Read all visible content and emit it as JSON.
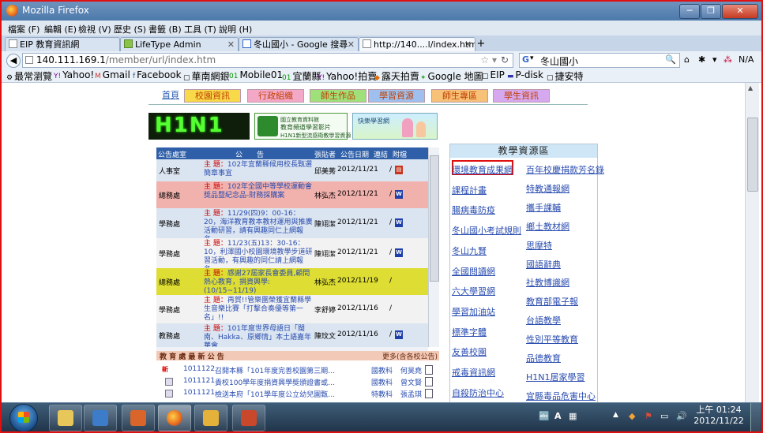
{
  "window": {
    "title": "Mozilla Firefox",
    "controls": {
      "minimize": "─",
      "maximize": "❐",
      "close": "✕"
    }
  },
  "menu": [
    "檔案 (F)",
    "編輯 (E)",
    "檢視 (V)",
    "歷史 (S)",
    "書籤 (B)",
    "工具 (T)",
    "說明 (H)"
  ],
  "tabs": [
    {
      "label": "EIP 教育資訊網"
    },
    {
      "label": "LifeType Admin"
    },
    {
      "label": "冬山國小 - Google 搜尋"
    },
    {
      "label": "http://140....l/index.htm"
    }
  ],
  "nav": {
    "url_host": "140.111.169.1",
    "url_path": "/member/url/index.htm",
    "search_engine": "G",
    "search_query": "冬山國小",
    "user_label": "N/A"
  },
  "bookmarks": [
    "最常瀏覽",
    "Yahoo!",
    "Gmail",
    "Facebook",
    "華南網銀",
    "Mobile01",
    "宜蘭縣",
    "Yahoo!拍賣",
    "露天拍賣",
    "Google 地圖",
    "EIP",
    "P-disk",
    "捷安特"
  ],
  "site_nav": [
    "首頁",
    "校園資訊",
    "行政組織",
    "師生作品",
    "學習資源",
    "師生專區",
    "學生資訊"
  ],
  "banners": {
    "h1n1": "H1N1",
    "edu_line1": "國立教育資料館",
    "edu_line2": "教育頻道學習影片",
    "edu_line3": "H1N1新型流感衛教學習資源",
    "kids_label": "快樂學習網"
  },
  "notices": {
    "headers": {
      "office": "公告處室",
      "subject": "公　　告",
      "publisher": "張貼者",
      "date": "公告日期",
      "link": "連結",
      "attach": "附檔"
    },
    "subject_label": "主 題：",
    "rows": [
      {
        "office": "人事室",
        "subject": "102年宜蘭縣候用校長甄選簡章事宜",
        "publisher": "邱美莠",
        "date": "2012/11/21",
        "attach": "pdf",
        "bg": "#dbe5f1"
      },
      {
        "office": "總務處",
        "subject": "102年全國中等學校運動會獎品暨紀念品-財務採購案",
        "publisher": "林弘杰",
        "date": "2012/11/21",
        "attach": "doc",
        "bg": "#f1b1ad"
      },
      {
        "office": "學務處",
        "subject": "11/29(四)9：00-16：20，海洋教育教本教材運用與推廣活動研習，請有興趣同仁上網報名。",
        "publisher": "陳翊潔",
        "date": "2012/11/21",
        "attach": "doc",
        "bg": "#dbe5f1"
      },
      {
        "office": "學務處",
        "subject": "11/23(五)13：30-16：10，利澤國小校園環境教學步道研習活動，有興趣的同仁請上網報名。",
        "publisher": "陳翊潔",
        "date": "2012/11/21",
        "attach": "doc",
        "bg": "#f2f2f2"
      },
      {
        "office": "總務處",
        "subject": "感謝27屆家長會委員,顧問熱心教育，捐資興學:(10/15~11/19)",
        "publisher": "林弘杰",
        "date": "2012/11/19",
        "attach": "",
        "bg": "#dddd33"
      },
      {
        "office": "學務處",
        "subject": "再賀!!管樂團榮獲宜蘭縣學生音樂比賽「打擊合奏優等第一名」!!",
        "publisher": "李舒婷",
        "date": "2012/11/16",
        "attach": "",
        "bg": "#f2f2f2"
      },
      {
        "office": "教務處",
        "subject": "101年度世界母語日「閩南、Hakka、原鄉情」本土語嘉年華會",
        "publisher": "陳玟文",
        "date": "2012/11/16",
        "attach": "doc",
        "bg": "#dbe5f1"
      }
    ]
  },
  "latest": {
    "title": "教 育 處 最 新 公 告",
    "more": "更多(含各校公告)",
    "items": [
      {
        "new": "新",
        "code": "1011122",
        "title": "召開本縣「101年度完善校園第三期…",
        "dept": "國教科",
        "author": "何昊堯"
      },
      {
        "new": "",
        "code": "1011121",
        "title": "貴校100學年度捐資興學獎頒證書或…",
        "dept": "國教科",
        "author": "曾文賢"
      },
      {
        "new": "",
        "code": "1011121",
        "title": "檢送本府「101學年度公立幼兒園甄…",
        "dept": "特教科",
        "author": "張孟琪"
      }
    ]
  },
  "resources": {
    "title": "教學資源區",
    "left": [
      "環境教育成果網",
      "課程計畫",
      "腸病毒防疫",
      "冬山國小考試規則",
      "冬山九賢",
      "全國閱讀網",
      "六大學習網",
      "學習加油站",
      "標準字體",
      "友善校園",
      "戒毒資訊網",
      "自殺防治中心"
    ],
    "right": [
      "百年校慶捐款芳名錄",
      "特教通報網",
      "攜手課輔",
      "鄉土教材網",
      "思摩特",
      "國語辭典",
      "社教博識網",
      "教育部電子報",
      "台語教學",
      "性別平等教育",
      "品德教育",
      "H1N1居家學習",
      "宜縣毒品危害中心"
    ],
    "highlighted": "環境教育成果網"
  },
  "taskbar": {
    "apps": [
      "explorer",
      "media-player",
      "photo-app",
      "firefox",
      "live-writer",
      "powerpoint"
    ],
    "tray": [
      "A",
      "▲"
    ],
    "time": "上午 01:24",
    "date": "2012/11/22"
  }
}
